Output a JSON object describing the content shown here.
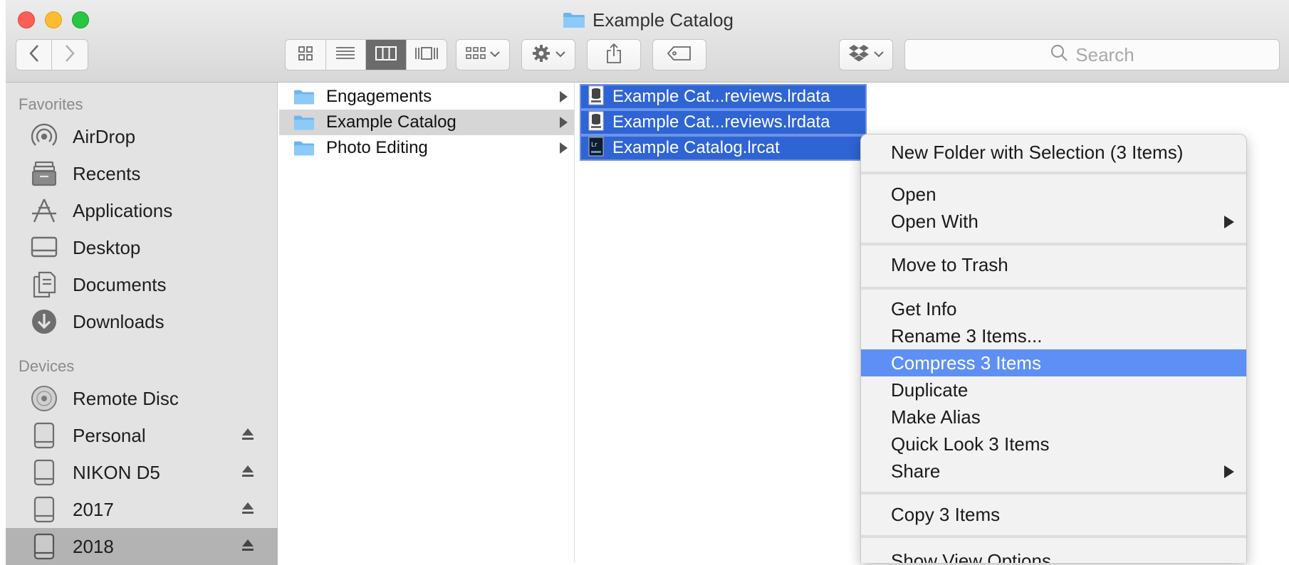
{
  "window": {
    "title": "Example Catalog",
    "colors": {
      "close": "#fd5f57",
      "minimize": "#febc2e",
      "zoom": "#27c840",
      "selection": "#2f64d4",
      "menu_highlight": "#5e8ff5"
    }
  },
  "toolbar": {
    "back_icon": "chevron-left-icon",
    "forward_icon": "chevron-right-icon",
    "view_icons": [
      "icon-view-icon",
      "list-view-icon",
      "column-view-icon",
      "cover-flow-icon"
    ],
    "active_view": "column-view-icon",
    "group_icon": "group-icon",
    "action_icon": "gear-icon",
    "share_icon": "share-icon",
    "tag_icon": "tag-icon",
    "dropbox_icon": "dropbox-icon",
    "search_placeholder": "Search"
  },
  "sidebar": {
    "favorites_heading": "Favorites",
    "favorites": [
      {
        "label": "AirDrop",
        "icon": "airdrop-icon"
      },
      {
        "label": "Recents",
        "icon": "recents-icon"
      },
      {
        "label": "Applications",
        "icon": "applications-icon"
      },
      {
        "label": "Desktop",
        "icon": "desktop-icon"
      },
      {
        "label": "Documents",
        "icon": "documents-icon"
      },
      {
        "label": "Downloads",
        "icon": "downloads-icon"
      }
    ],
    "devices_heading": "Devices",
    "devices": [
      {
        "label": "Remote Disc",
        "icon": "disc-icon",
        "eject": false
      },
      {
        "label": "Personal",
        "icon": "drive-icon",
        "eject": true
      },
      {
        "label": "NIKON D5",
        "icon": "drive-icon",
        "eject": true
      },
      {
        "label": "2017",
        "icon": "drive-icon",
        "eject": true
      },
      {
        "label": "2018",
        "icon": "drive-icon",
        "eject": true,
        "selected": true
      }
    ]
  },
  "columns": {
    "first": [
      {
        "label": "Engagements",
        "selected": false
      },
      {
        "label": "Example Catalog",
        "selected": true
      },
      {
        "label": "Photo Editing",
        "selected": false
      }
    ],
    "second": [
      {
        "label": "Example Cat...reviews.lrdata",
        "icon": "lrdata-icon"
      },
      {
        "label": "Example Cat...reviews.lrdata",
        "icon": "lrdata-icon"
      },
      {
        "label": "Example Catalog.lrcat",
        "icon": "lrcat-icon"
      }
    ]
  },
  "context_menu": {
    "items": [
      {
        "label": "New Folder with Selection (3 Items)"
      },
      {
        "label": "Open"
      },
      {
        "label": "Open With",
        "submenu": true
      },
      {
        "label": "Move to Trash"
      },
      {
        "label": "Get Info"
      },
      {
        "label": "Rename 3 Items..."
      },
      {
        "label": "Compress 3 Items",
        "highlighted": true
      },
      {
        "label": "Duplicate"
      },
      {
        "label": "Make Alias"
      },
      {
        "label": "Quick Look 3 Items"
      },
      {
        "label": "Share",
        "submenu": true
      },
      {
        "label": "Copy 3 Items"
      },
      {
        "label": "Show View Options"
      }
    ]
  }
}
